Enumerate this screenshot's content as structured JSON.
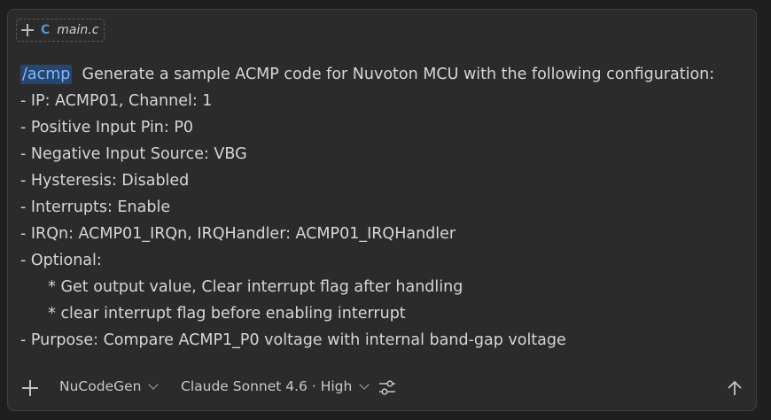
{
  "attachment": {
    "file_name": "main.c",
    "file_type_glyph": "C",
    "add_icon": "plus-icon"
  },
  "prompt": {
    "command": "/acmp",
    "first_line": "  Generate a sample ACMP code for Nuvoton MCU with the following configuration:",
    "lines": [
      "- IP: ACMP01, Channel: 1",
      "- Positive Input Pin: P0",
      "- Negative Input Source: VBG",
      "- Hysteresis: Disabled",
      "- Interrupts: Enable",
      "- IRQn: ACMP01_IRQn, IRQHandler: ACMP01_IRQHandler",
      "- Optional:",
      "  * Get output value, Clear interrupt flag after handling",
      "  * clear interrupt flag before enabling interrupt",
      "- Purpose: Compare ACMP1_P0 voltage with internal band-gap voltage"
    ]
  },
  "toolbar": {
    "agent_label": "NuCodeGen",
    "model_label": "Claude Sonnet 4.6 · High",
    "icons": [
      "plus-icon",
      "chevron-down-icon",
      "sliders-icon",
      "arrow-up-icon"
    ]
  },
  "colors": {
    "background": "#1f1f1f",
    "panel": "#2b2b2b",
    "command_highlight": "#26466e",
    "command_text": "#7fb9ff",
    "c_icon": "#4a9bd6"
  }
}
